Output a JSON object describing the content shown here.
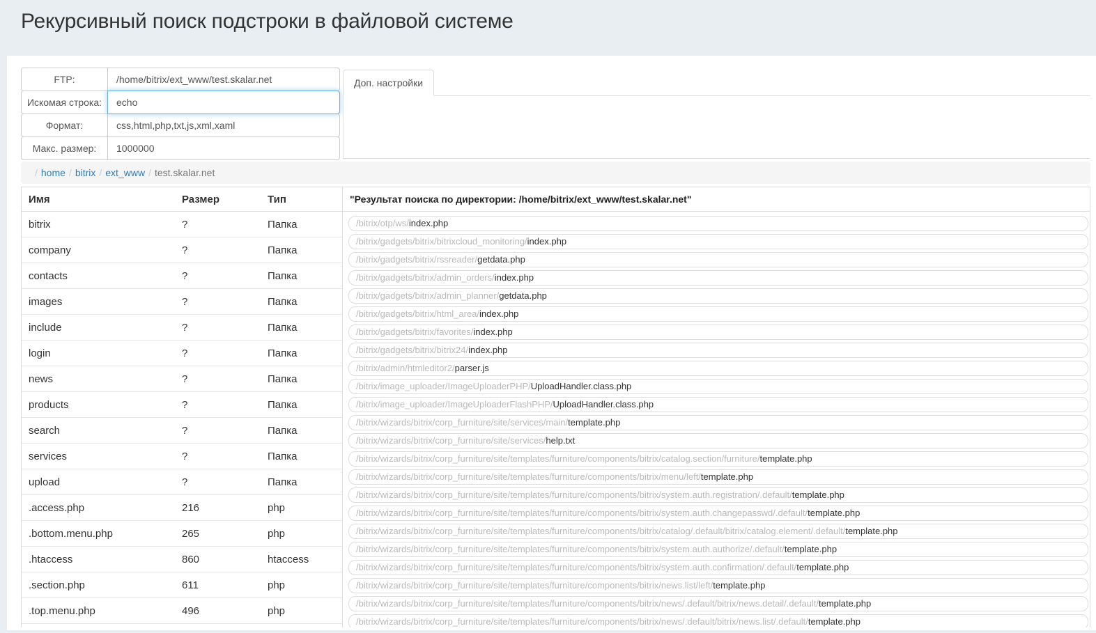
{
  "page": {
    "title": "Рекурсивный поиск подстроки в файловой системе"
  },
  "colors": {
    "page_background": "#e9eef3",
    "focus_border": "#66afe9",
    "link": "#337ab7",
    "muted_path": "#b9b9b9",
    "border": "#dddddd"
  },
  "form": {
    "fields": [
      {
        "id": "ftp",
        "label": "FTP:",
        "value": "/home/bitrix/ext_www/test.skalar.net",
        "focused": false
      },
      {
        "id": "query",
        "label": "Искомая строка:",
        "value": "echo",
        "focused": true
      },
      {
        "id": "format",
        "label": "Формат:",
        "value": "css,html,php,txt,js,xml,xaml",
        "focused": false
      },
      {
        "id": "max-size",
        "label": "Макс. размер:",
        "value": "1000000",
        "focused": false
      }
    ]
  },
  "tabs": {
    "items": [
      {
        "id": "extra-settings",
        "label": "Доп. настройки",
        "active": true
      }
    ]
  },
  "breadcrumb": {
    "items": [
      {
        "label": "home",
        "link": true
      },
      {
        "label": "bitrix",
        "link": true
      },
      {
        "label": "ext_www",
        "link": true
      },
      {
        "label": "test.skalar.net",
        "link": false
      }
    ]
  },
  "file_table": {
    "columns": [
      "Имя",
      "Размер",
      "Тип"
    ],
    "rows": [
      {
        "name": "bitrix",
        "size": "?",
        "type": "Папка"
      },
      {
        "name": "company",
        "size": "?",
        "type": "Папка"
      },
      {
        "name": "contacts",
        "size": "?",
        "type": "Папка"
      },
      {
        "name": "images",
        "size": "?",
        "type": "Папка"
      },
      {
        "name": "include",
        "size": "?",
        "type": "Папка"
      },
      {
        "name": "login",
        "size": "?",
        "type": "Папка"
      },
      {
        "name": "news",
        "size": "?",
        "type": "Папка"
      },
      {
        "name": "products",
        "size": "?",
        "type": "Папка"
      },
      {
        "name": "search",
        "size": "?",
        "type": "Папка"
      },
      {
        "name": "services",
        "size": "?",
        "type": "Папка"
      },
      {
        "name": "upload",
        "size": "?",
        "type": "Папка"
      },
      {
        "name": ".access.php",
        "size": "216",
        "type": "php"
      },
      {
        "name": ".bottom.menu.php",
        "size": "265",
        "type": "php"
      },
      {
        "name": ".htaccess",
        "size": "860",
        "type": "htaccess"
      },
      {
        "name": ".section.php",
        "size": "611",
        "type": "php"
      },
      {
        "name": ".top.menu.php",
        "size": "496",
        "type": "php"
      }
    ]
  },
  "results": {
    "header": "\"Результат поиска по директории: /home/bitrix/ext_www/test.skalar.net\"",
    "items": [
      {
        "path": "/bitrix/otp/ws/",
        "file": "index.php"
      },
      {
        "path": "/bitrix/gadgets/bitrix/bitrixcloud_monitoring/",
        "file": "index.php"
      },
      {
        "path": "/bitrix/gadgets/bitrix/rssreader/",
        "file": "getdata.php"
      },
      {
        "path": "/bitrix/gadgets/bitrix/admin_orders/",
        "file": "index.php"
      },
      {
        "path": "/bitrix/gadgets/bitrix/admin_planner/",
        "file": "getdata.php"
      },
      {
        "path": "/bitrix/gadgets/bitrix/html_area/",
        "file": "index.php"
      },
      {
        "path": "/bitrix/gadgets/bitrix/favorites/",
        "file": "index.php"
      },
      {
        "path": "/bitrix/gadgets/bitrix/bitrix24/",
        "file": "index.php"
      },
      {
        "path": "/bitrix/admin/htmleditor2/",
        "file": "parser.js"
      },
      {
        "path": "/bitrix/image_uploader/ImageUploaderPHP/",
        "file": "UploadHandler.class.php"
      },
      {
        "path": "/bitrix/image_uploader/ImageUploaderFlashPHP/",
        "file": "UploadHandler.class.php"
      },
      {
        "path": "/bitrix/wizards/bitrix/corp_furniture/site/services/main/",
        "file": "template.php"
      },
      {
        "path": "/bitrix/wizards/bitrix/corp_furniture/site/services/",
        "file": "help.txt"
      },
      {
        "path": "/bitrix/wizards/bitrix/corp_furniture/site/templates/furniture/components/bitrix/catalog.section/furniture/",
        "file": "template.php"
      },
      {
        "path": "/bitrix/wizards/bitrix/corp_furniture/site/templates/furniture/components/bitrix/menu/left/",
        "file": "template.php"
      },
      {
        "path": "/bitrix/wizards/bitrix/corp_furniture/site/templates/furniture/components/bitrix/system.auth.registration/.default/",
        "file": "template.php"
      },
      {
        "path": "/bitrix/wizards/bitrix/corp_furniture/site/templates/furniture/components/bitrix/system.auth.changepasswd/.default/",
        "file": "template.php"
      },
      {
        "path": "/bitrix/wizards/bitrix/corp_furniture/site/templates/furniture/components/bitrix/catalog/.default/bitrix/catalog.element/.default/",
        "file": "template.php"
      },
      {
        "path": "/bitrix/wizards/bitrix/corp_furniture/site/templates/furniture/components/bitrix/system.auth.authorize/.default/",
        "file": "template.php"
      },
      {
        "path": "/bitrix/wizards/bitrix/corp_furniture/site/templates/furniture/components/bitrix/system.auth.confirmation/.default/",
        "file": "template.php"
      },
      {
        "path": "/bitrix/wizards/bitrix/corp_furniture/site/templates/furniture/components/bitrix/news.list/left/",
        "file": "template.php"
      },
      {
        "path": "/bitrix/wizards/bitrix/corp_furniture/site/templates/furniture/components/bitrix/news/.default/bitrix/news.detail/.default/",
        "file": "template.php"
      },
      {
        "path": "/bitrix/wizards/bitrix/corp_furniture/site/templates/furniture/components/bitrix/news/.default/bitrix/news.list/.default/",
        "file": "template.php"
      }
    ]
  }
}
